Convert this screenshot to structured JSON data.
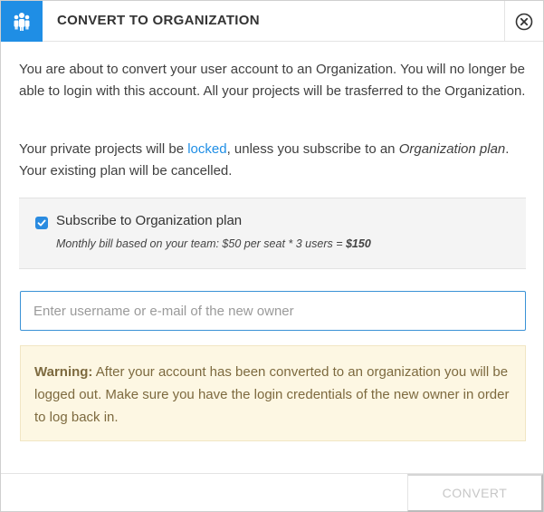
{
  "dialog": {
    "title": "CONVERT TO ORGANIZATION",
    "header_icon": "organization-icon",
    "close_icon": "close-circle-icon",
    "accent_color": "#1f8ee5"
  },
  "intro": {
    "text": "You are about to convert your user account to an Organization. You will no longer be able to login with this account. All your projects will be trasferred to the Organization."
  },
  "private_note": {
    "before": "Your private projects will be ",
    "link": "locked",
    "middle": ", unless you subscribe to an ",
    "emphasis": "Organization plan",
    "after": ". Your existing plan will be cancelled."
  },
  "subscribe": {
    "checked": true,
    "label": "Subscribe to Organization plan",
    "note_prefix": "Monthly bill based on your team: $50 per seat * 3 users = ",
    "note_total": "$150"
  },
  "owner_input": {
    "value": "",
    "placeholder": "Enter username or e-mail of the new owner"
  },
  "warning": {
    "label": "Warning:",
    "text": " After your account has been converted to an organization you will be logged out. Make sure you have the login credentials of the new owner in order to log back in."
  },
  "footer": {
    "convert_label": "CONVERT",
    "convert_enabled": false
  }
}
